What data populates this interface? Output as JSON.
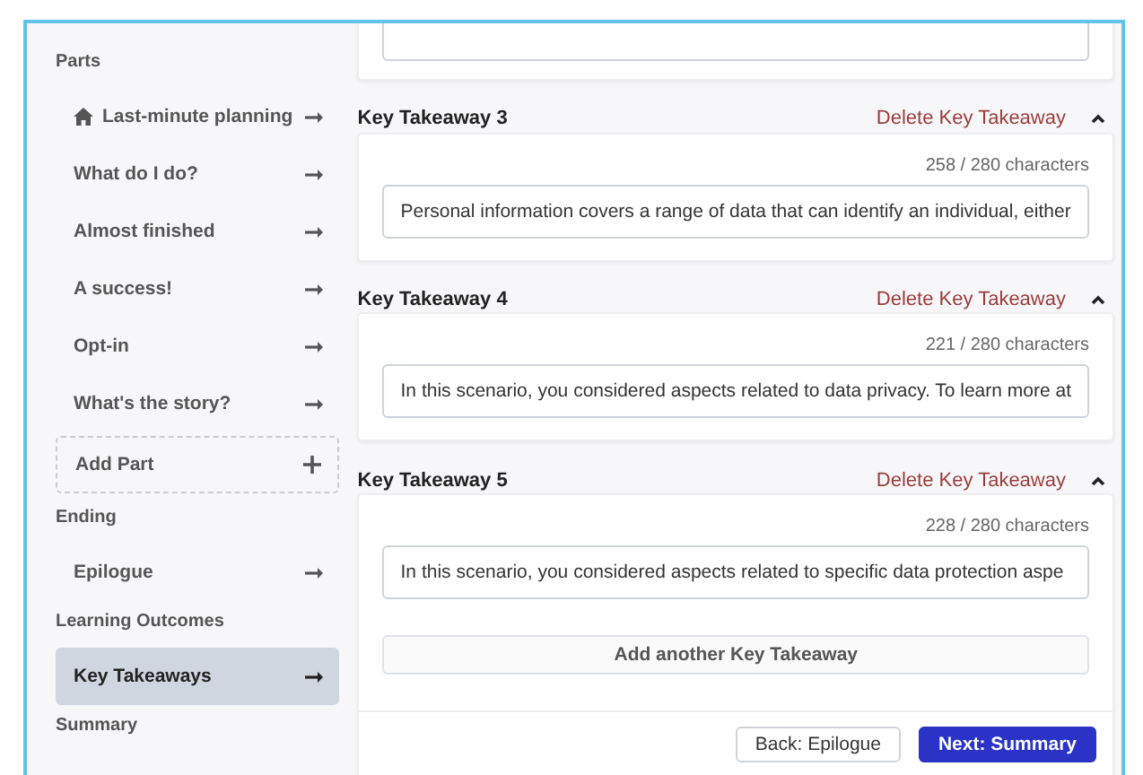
{
  "sidebar": {
    "sections": [
      {
        "heading": "Parts",
        "items": [
          {
            "label": "Last-minute planning",
            "kind": "home",
            "selected": false
          },
          {
            "label": "What do I do?",
            "kind": "page",
            "selected": false
          },
          {
            "label": "Almost finished",
            "kind": "page",
            "selected": false
          },
          {
            "label": "A success!",
            "kind": "page",
            "selected": false
          },
          {
            "label": "Opt-in",
            "kind": "page",
            "selected": false
          },
          {
            "label": "What's the story?",
            "kind": "page",
            "selected": false
          },
          {
            "label": "Add Part",
            "kind": "add",
            "selected": false
          }
        ]
      },
      {
        "heading": "Ending",
        "items": [
          {
            "label": "Epilogue",
            "kind": "page",
            "selected": false
          }
        ]
      },
      {
        "heading": "Learning Outcomes",
        "items": [
          {
            "label": "Key Takeaways",
            "kind": "page",
            "selected": true
          }
        ]
      },
      {
        "heading": "Summary"
      }
    ]
  },
  "takeaways": [
    {
      "title": "Key Takeaway 3",
      "delete": "Delete Key Takeaway",
      "expanded": true,
      "count": "258 / 280 characters",
      "value": "Personal information covers a range of data that can identify an individual, either"
    },
    {
      "title": "Key Takeaway 4",
      "delete": "Delete Key Takeaway",
      "expanded": true,
      "count": "221 / 280 characters",
      "value": "In this scenario, you considered aspects related to data privacy. To learn more at"
    },
    {
      "title": "Key Takeaway 5",
      "delete": "Delete Key Takeaway",
      "expanded": true,
      "count": "228 / 280 characters",
      "value": "In this scenario, you considered aspects related to specific data protection aspe"
    }
  ],
  "add_button": "Add another Key Takeaway",
  "footer": {
    "back": "Back: Epilogue",
    "next": "Next: Summary"
  }
}
